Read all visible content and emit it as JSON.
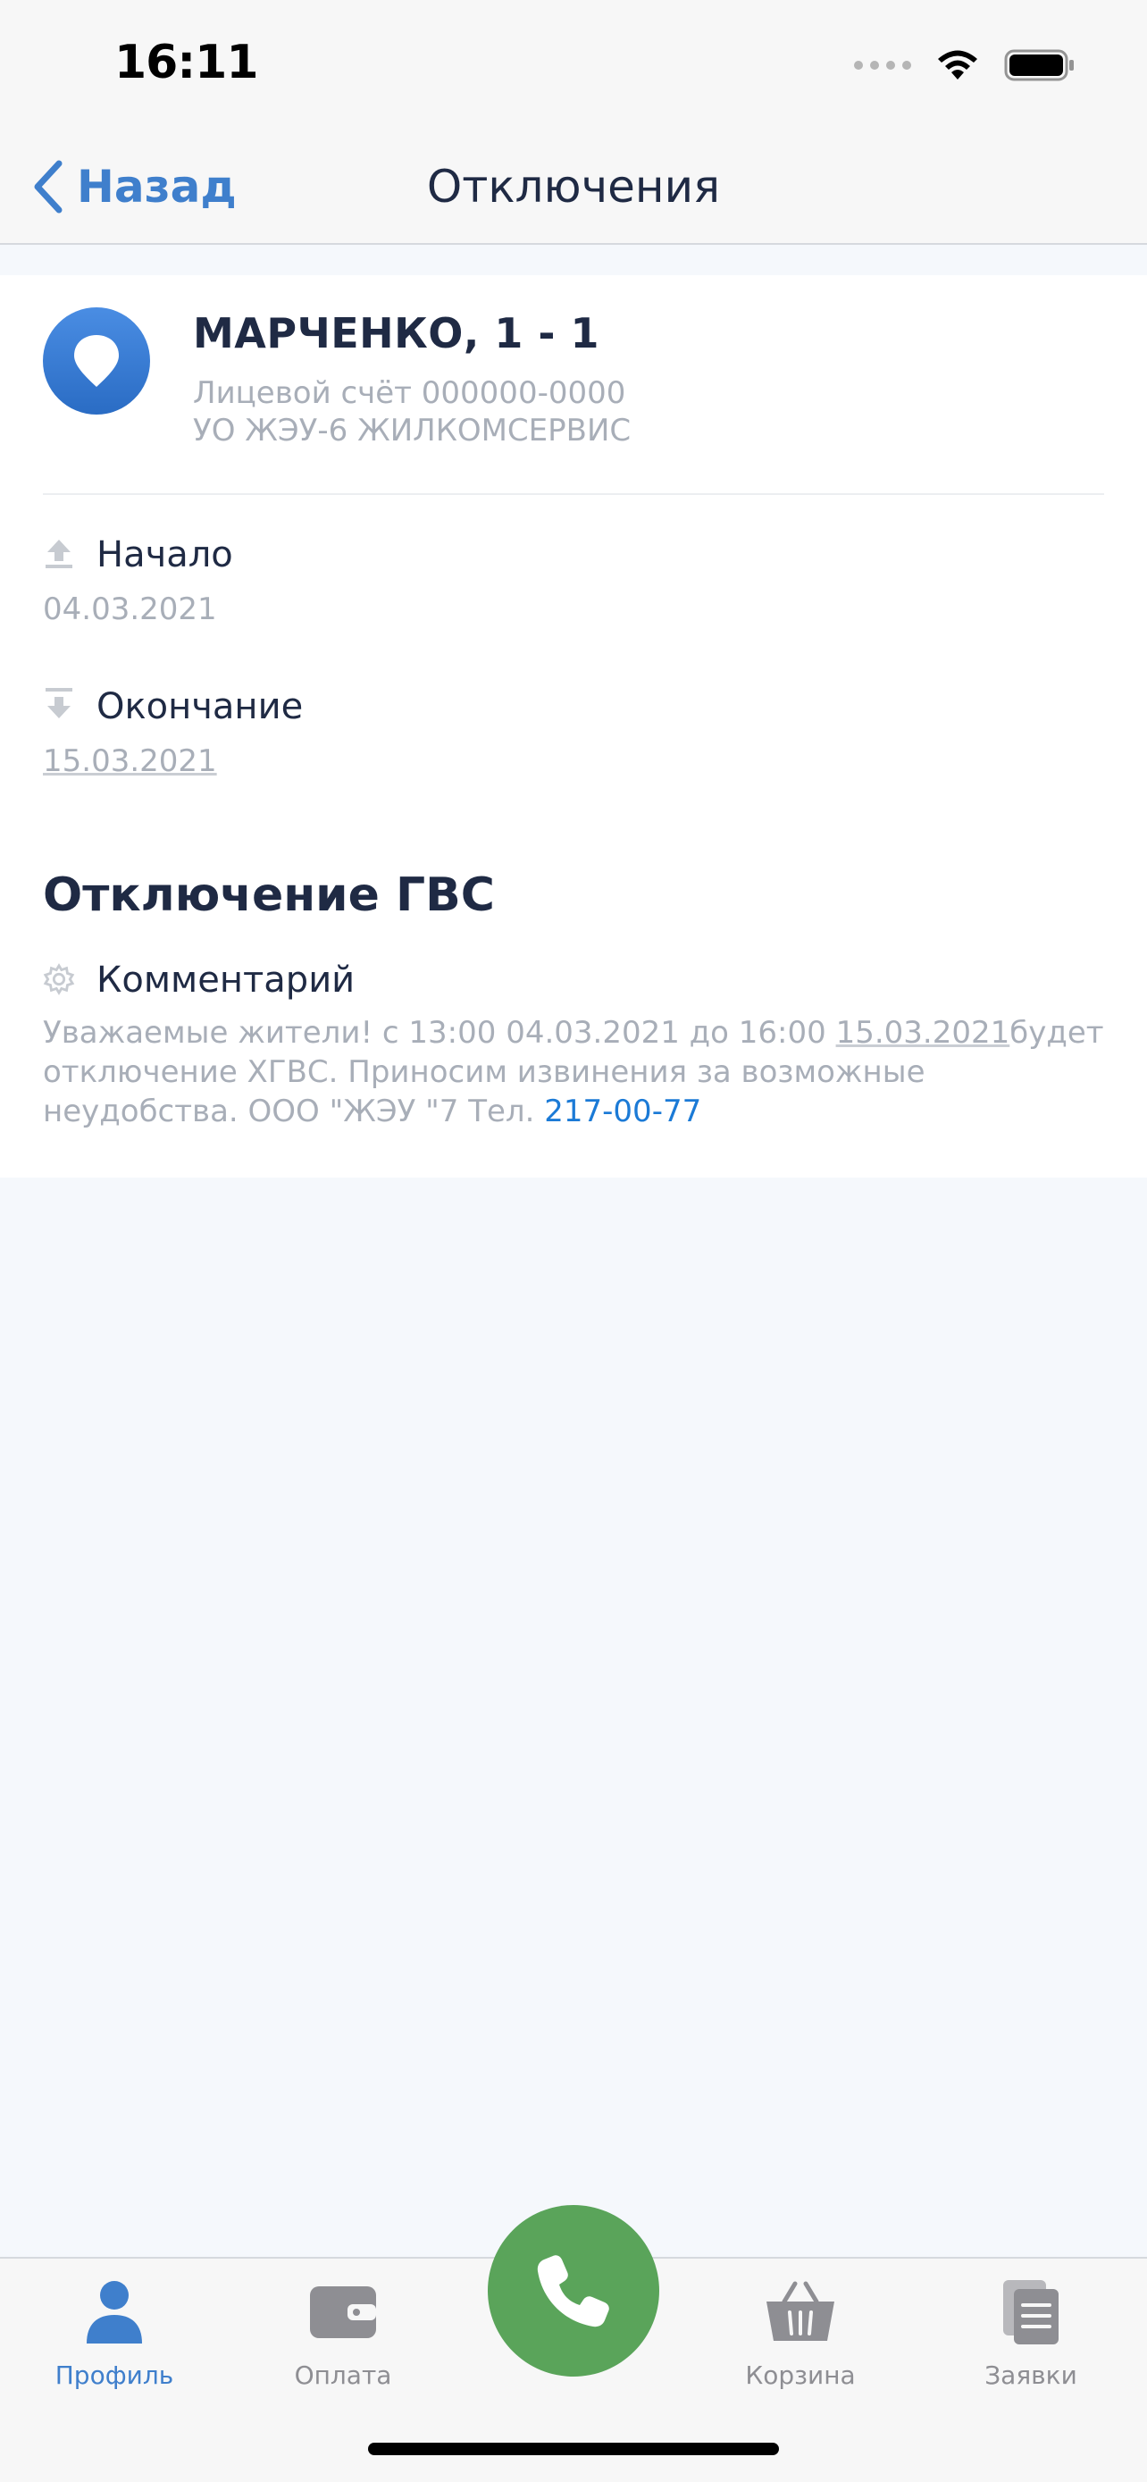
{
  "status_bar": {
    "time": "16:11"
  },
  "nav": {
    "back_label": "Назад",
    "title": "Отключения"
  },
  "card": {
    "address": "МАРЧЕНКО, 1 - 1",
    "account": "Лицевой счёт 000000-0000",
    "organization": "УО ЖЭУ-6 ЖИЛКОМСЕРВИС",
    "start": {
      "label": "Начало",
      "value": "04.03.2021"
    },
    "end": {
      "label": "Окончание",
      "value": "15.03.2021"
    },
    "section_title": "Отключение ГВС",
    "comment": {
      "label": "Комментарий",
      "text_part1": "Уважаемые жители! с 13:00 04.03.2021 до 16:00 ",
      "text_date": "15.03.2021",
      "text_part2": "будет отключение ХГВС. Приносим извинения за возможные неудобства. ООО \"ЖЭУ \"7 Тел. ",
      "phone": "217-00-77"
    }
  },
  "tabs": [
    {
      "label": "Профиль",
      "icon": "person-icon",
      "active": true
    },
    {
      "label": "Оплата",
      "icon": "wallet-icon",
      "active": false
    },
    {
      "label": "Корзина",
      "icon": "basket-icon",
      "active": false
    },
    {
      "label": "Заявки",
      "icon": "documents-icon",
      "active": false
    }
  ],
  "call_button": {
    "icon": "phone-icon"
  },
  "colors": {
    "accent": "#3f7fcc",
    "call_green": "#5aa45a",
    "link": "#1b7ad6",
    "muted_text": "#a8aeb8"
  }
}
